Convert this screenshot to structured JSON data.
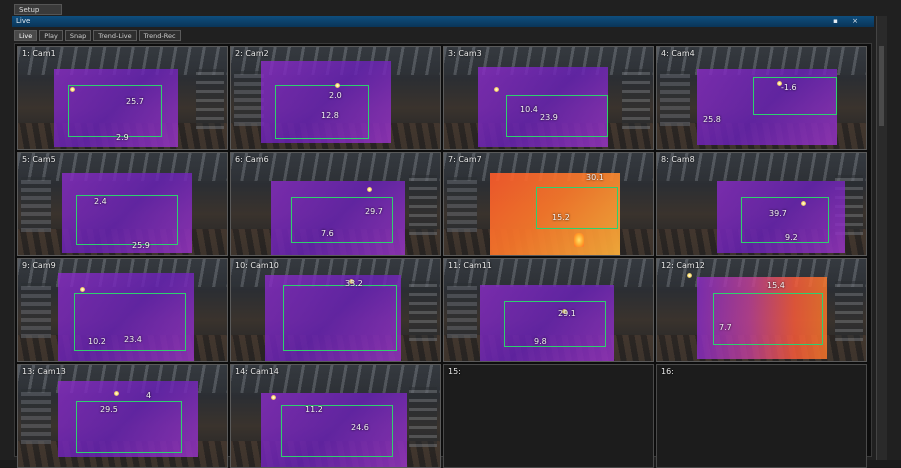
{
  "window": {
    "title": "Setup"
  },
  "panel": {
    "title": "Live",
    "controls": "▪ ×"
  },
  "tabs": [
    {
      "label": "Live",
      "active": true
    },
    {
      "label": "Play",
      "active": false
    },
    {
      "label": "Snap",
      "active": false
    },
    {
      "label": "Trend-Live",
      "active": false
    },
    {
      "label": "Trend-Rec",
      "active": false
    }
  ],
  "cameras": [
    {
      "label": "1: Cam1",
      "temps": [
        "25.7",
        "2.9"
      ]
    },
    {
      "label": "2: Cam2",
      "temps": [
        "2.0",
        "12.8"
      ]
    },
    {
      "label": "3: Cam3",
      "temps": [
        "10.4",
        "23.9"
      ]
    },
    {
      "label": "4: Cam4",
      "temps": [
        "-1.6",
        "25.8"
      ]
    },
    {
      "label": "5: Cam5",
      "temps": [
        "2.4",
        "25.9"
      ]
    },
    {
      "label": "6: Cam6",
      "temps": [
        "29.7",
        "7.6"
      ]
    },
    {
      "label": "7: Cam7",
      "temps": [
        "30.1",
        "15.2"
      ]
    },
    {
      "label": "8: Cam8",
      "temps": [
        "39.7",
        "9.2"
      ]
    },
    {
      "label": "9: Cam9",
      "temps": [
        "10.2",
        "23.4"
      ]
    },
    {
      "label": "10: Cam10",
      "temps": [
        "33.2"
      ]
    },
    {
      "label": "11: Cam11",
      "temps": [
        "29.1",
        "9.8"
      ]
    },
    {
      "label": "12: Cam12",
      "temps": [
        "15.4",
        "7.7"
      ]
    },
    {
      "label": "13: Cam13",
      "temps": [
        "29.5",
        "4"
      ]
    },
    {
      "label": "14: Cam14",
      "temps": [
        "11.2",
        "24.6"
      ]
    },
    {
      "label": "15:"
    },
    {
      "label": "16:"
    }
  ]
}
